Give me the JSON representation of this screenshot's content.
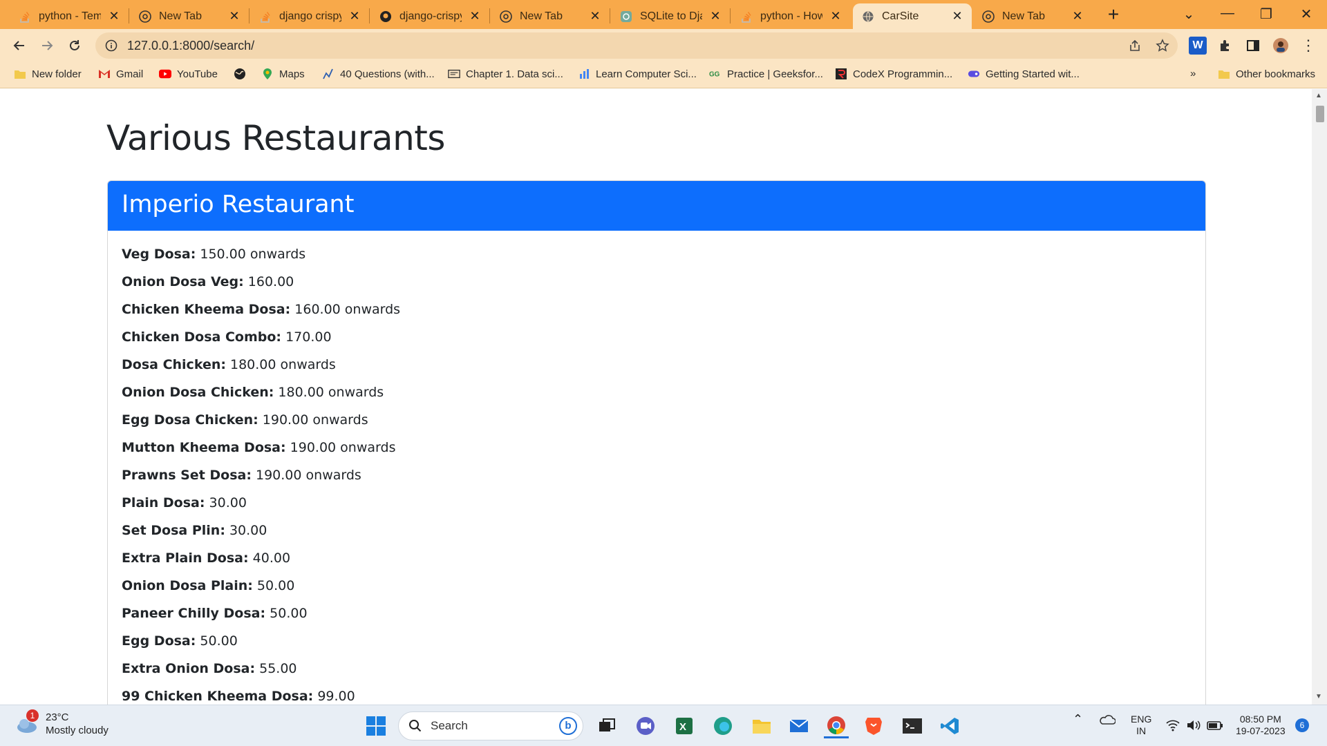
{
  "browser": {
    "tabs": [
      {
        "title": "python - Temp",
        "icon": "stackoverflow-icon",
        "active": false
      },
      {
        "title": "New Tab",
        "icon": "chrome-icon",
        "active": false
      },
      {
        "title": "django crispy",
        "icon": "stackoverflow-icon",
        "active": false
      },
      {
        "title": "django-crispy-",
        "icon": "github-icon",
        "active": false
      },
      {
        "title": "New Tab",
        "icon": "chrome-icon",
        "active": false
      },
      {
        "title": "SQLite to Djar",
        "icon": "openai-icon",
        "active": false
      },
      {
        "title": "python - How",
        "icon": "stackoverflow-icon",
        "active": false
      },
      {
        "title": "CarSite",
        "icon": "globe-icon",
        "active": true
      },
      {
        "title": "New Tab",
        "icon": "chrome-icon",
        "active": false
      }
    ],
    "url": "127.0.0.1:8000/search/",
    "bookmarks": [
      {
        "label": "New folder",
        "icon": "folder-icon"
      },
      {
        "label": "Gmail",
        "icon": "gmail-icon"
      },
      {
        "label": "YouTube",
        "icon": "youtube-icon"
      },
      {
        "label": "",
        "icon": "globe-icon"
      },
      {
        "label": "Maps",
        "icon": "maps-icon"
      },
      {
        "label": "40 Questions (with...",
        "icon": "chart-icon"
      },
      {
        "label": "Chapter 1. Data sci...",
        "icon": "book-icon"
      },
      {
        "label": "Learn Computer Sci...",
        "icon": "bars-icon"
      },
      {
        "label": "Practice | Geeksfor...",
        "icon": "gfg-icon"
      },
      {
        "label": "CodeX Programmin...",
        "icon": "codex-icon"
      },
      {
        "label": "Getting Started wit...",
        "icon": "tag-icon"
      }
    ],
    "other_bookmarks": "Other bookmarks",
    "overflow": "»"
  },
  "page": {
    "title": "Various Restaurants",
    "restaurant": {
      "name": "Imperio Restaurant",
      "items": [
        {
          "name": "Veg Dosa:",
          "price": "150.00 onwards"
        },
        {
          "name": "Onion Dosa Veg:",
          "price": "160.00"
        },
        {
          "name": "Chicken Kheema Dosa:",
          "price": "160.00 onwards"
        },
        {
          "name": "Chicken Dosa Combo:",
          "price": "170.00"
        },
        {
          "name": "Dosa Chicken:",
          "price": "180.00 onwards"
        },
        {
          "name": "Onion Dosa Chicken:",
          "price": "180.00 onwards"
        },
        {
          "name": "Egg Dosa Chicken:",
          "price": "190.00 onwards"
        },
        {
          "name": "Mutton Kheema Dosa:",
          "price": "190.00 onwards"
        },
        {
          "name": "Prawns Set Dosa:",
          "price": "190.00 onwards"
        },
        {
          "name": "Plain Dosa:",
          "price": "30.00"
        },
        {
          "name": "Set Dosa Plin:",
          "price": "30.00"
        },
        {
          "name": "Extra Plain Dosa:",
          "price": "40.00"
        },
        {
          "name": "Onion Dosa Plain:",
          "price": "50.00"
        },
        {
          "name": "Paneer Chilly Dosa:",
          "price": "50.00"
        },
        {
          "name": "Egg Dosa:",
          "price": "50.00"
        },
        {
          "name": "Extra Onion Dosa:",
          "price": "55.00"
        },
        {
          "name": "99 Chicken Kheema Dosa:",
          "price": "99.00"
        }
      ]
    }
  },
  "taskbar": {
    "weather_temp": "23°C",
    "weather_desc": "Mostly cloudy",
    "weather_badge": "1",
    "search_label": "Search",
    "lang": "ENG",
    "region": "IN",
    "time": "08:50 PM",
    "date": "19-07-2023",
    "notif_count": "6"
  },
  "colors": {
    "tabstrip": "#f8a94a",
    "toolbar": "#fbe5c4",
    "card_header": "#0d6efd"
  }
}
